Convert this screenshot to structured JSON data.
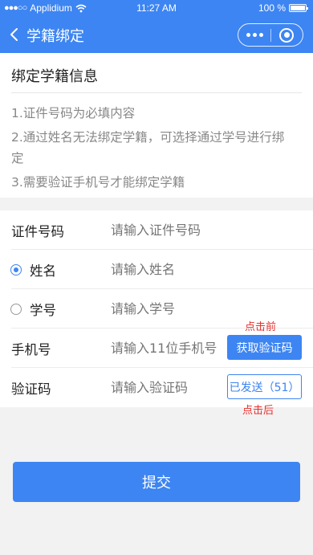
{
  "statusbar": {
    "carrier": "Applidium",
    "time": "11:27 AM",
    "battery": "100 %"
  },
  "navbar": {
    "title": "学籍绑定",
    "icons": [
      "back-chevron-icon",
      "more-dots-icon",
      "close-target-icon"
    ]
  },
  "info": {
    "title": "绑定学籍信息",
    "tips": [
      "1.证件号码为必填内容",
      "2.通过姓名无法绑定学籍，可选择通过学号进行绑定",
      "3.需要验证手机号才能绑定学籍"
    ]
  },
  "form": {
    "id_number": {
      "label": "证件号码",
      "placeholder": "请输入证件号码"
    },
    "name": {
      "label": "姓名",
      "placeholder": "请输入姓名",
      "selected": true
    },
    "student_id": {
      "label": "学号",
      "placeholder": "请输入学号",
      "selected": false
    },
    "phone": {
      "label": "手机号",
      "placeholder": "请输入11位手机号",
      "button": "获取验证码",
      "note": "点击前"
    },
    "code": {
      "label": "验证码",
      "placeholder": "请输入验证码",
      "sent_button": "已发送（51）",
      "note": "点击后"
    }
  },
  "submit_label": "提交",
  "colors": {
    "primary": "#3d85f2",
    "note_red": "#e8302c",
    "placeholder": "#9a9a9a"
  }
}
